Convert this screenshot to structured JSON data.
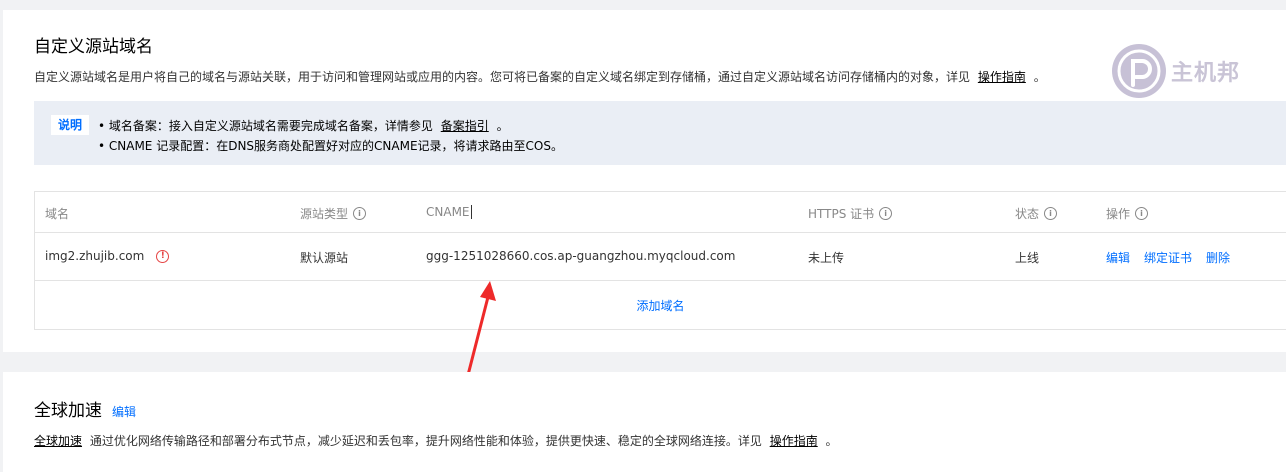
{
  "custom_domain": {
    "title": "自定义源站域名",
    "desc_text": "自定义源站域名是用户将自己的域名与源站关联，用于访问和管理网站或应用的内容。您可将已备案的自定义域名绑定到存储桶，通过自定义源站域名访问存储桶内的对象，详见",
    "guide_link": "操作指南",
    "desc_end": "。",
    "notice": {
      "tag": "说明",
      "item1_text": "• 域名备案：接入自定义源站域名需要完成域名备案，详情参见",
      "item1_link": "备案指引",
      "item1_end": "。",
      "item2_text": "• CNAME 记录配置：在DNS服务商处配置好对应的CNAME记录，将请求路由至COS。"
    },
    "table": {
      "headers": {
        "domain": "域名",
        "origin_type": "源站类型",
        "cname": "CNAME",
        "https": "HTTPS 证书",
        "status": "状态",
        "actions": "操作"
      },
      "rows": [
        {
          "domain": "img2.zhujib.com",
          "origin_type": "默认源站",
          "cname": "ggg-1251028660.cos.ap-guangzhou.myqcloud.com",
          "https": "未上传",
          "status": "上线",
          "actions": [
            "编辑",
            "绑定证书",
            "删除"
          ]
        }
      ],
      "add_label": "添加域名"
    }
  },
  "global_accel": {
    "title": "全球加速",
    "edit_label": "编辑",
    "link": "全球加速",
    "desc_text": "通过优化网络传输路径和部署分布式节点，减少延迟和丢包率，提升网络性能和体验，提供更快速、稳定的全球网络连接。详见",
    "guide_link": "操作指南",
    "desc_end": "。"
  },
  "watermark": {
    "text": "主机邦",
    "icon": "p-logo-icon"
  },
  "colors": {
    "accent": "#006eff",
    "warn": "#e54545",
    "arrow": "#ee2a2a"
  }
}
